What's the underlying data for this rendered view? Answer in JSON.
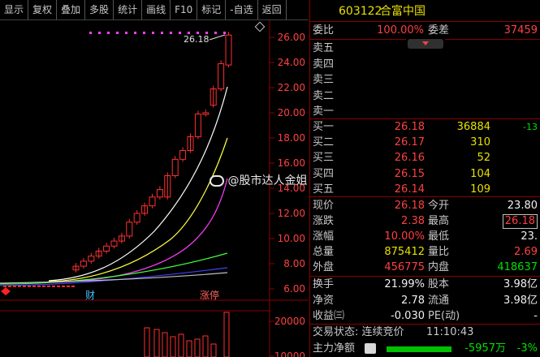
{
  "toolbar": {
    "buttons": [
      "显示",
      "复权",
      "叠加",
      "多股",
      "统计",
      "画线",
      "F10",
      "标记",
      "-自选",
      "返回"
    ]
  },
  "chart": {
    "price_ticks": [
      "26.00",
      "24.00",
      "22.00",
      "20.00",
      "18.00",
      "16.00",
      "14.00",
      "12.00",
      "10.00",
      "8.00",
      "6.00"
    ],
    "volume_ticks": [
      "20000",
      "10000"
    ],
    "high_marker": "26.18",
    "event_labels": [
      "财",
      "涨停"
    ],
    "colors": {
      "up": "#ff3030",
      "down": "#00c0c0",
      "ma1": "#ffffff",
      "ma2": "#ffff40",
      "ma3": "#ff40ff",
      "ma4": "#40ff40",
      "ma5": "#4040ff"
    }
  },
  "quote": {
    "code": "603122",
    "name": "合富中国",
    "weibi_label": "委比",
    "weibi_value": "100.00%",
    "weicha_label": "委差",
    "weicha_value": "37459",
    "sells": [
      {
        "label": "卖五"
      },
      {
        "label": "卖四"
      },
      {
        "label": "卖三"
      },
      {
        "label": "卖二"
      },
      {
        "label": "卖一"
      }
    ],
    "buys": [
      {
        "label": "买一",
        "price": "26.18",
        "vol": "36884",
        "chg": "-13"
      },
      {
        "label": "买二",
        "price": "26.17",
        "vol": "310",
        "chg": ""
      },
      {
        "label": "买三",
        "price": "26.16",
        "vol": "52",
        "chg": ""
      },
      {
        "label": "买四",
        "price": "26.15",
        "vol": "104",
        "chg": ""
      },
      {
        "label": "买五",
        "price": "26.14",
        "vol": "109",
        "chg": ""
      }
    ],
    "stats": [
      {
        "l1": "现价",
        "v1": "26.18",
        "l2": "今开",
        "v2": "23.80"
      },
      {
        "l1": "涨跌",
        "v1": "2.38",
        "l2": "最高",
        "v2": "26.18"
      },
      {
        "l1": "涨幅",
        "v1": "10.00%",
        "l2": "最低",
        "v2": "23."
      },
      {
        "l1": "总量",
        "v1": "875412",
        "l2": "量比",
        "v2": "2.69"
      },
      {
        "l1": "外盘",
        "v1": "456775",
        "l2": "内盘",
        "v2": "418637"
      }
    ],
    "stats2": [
      {
        "l1": "换手",
        "v1": "21.99%",
        "l2": "股本",
        "v2": "3.98亿"
      },
      {
        "l1": "净资",
        "v1": "2.78",
        "l2": "流通",
        "v2": "3.98亿"
      },
      {
        "l1": "收益㈢",
        "v1": "-0.030",
        "l2": "PE(动)",
        "v2": "-"
      }
    ],
    "trade_status": "交易状态: 连续竞价",
    "trade_time": "11:10:43",
    "main_flow_label": "主力净额",
    "main_flow_value": "-5957万",
    "main_flow_pct": "-3%"
  },
  "watermark": "@股市达人金姐"
}
